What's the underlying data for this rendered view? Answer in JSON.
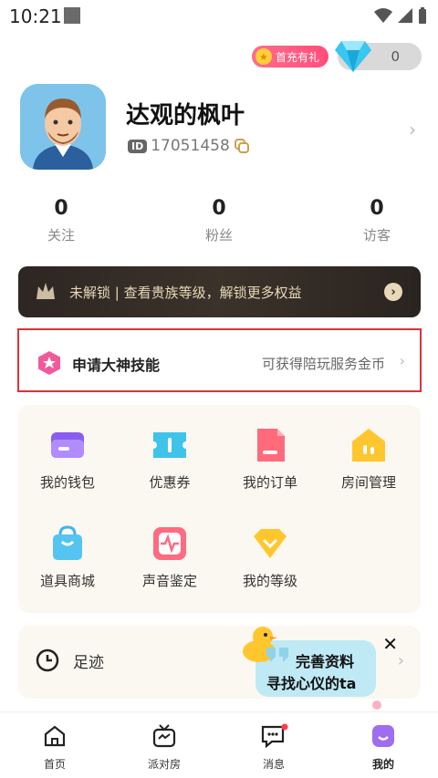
{
  "status_bar": {
    "time": "10:21"
  },
  "top": {
    "gift_label": "首充有礼",
    "diamond_count": "0"
  },
  "profile": {
    "name": "达观的枫叶",
    "id_badge": "ID",
    "user_id": "17051458"
  },
  "stats": [
    {
      "value": "0",
      "label": "关注"
    },
    {
      "value": "0",
      "label": "粉丝"
    },
    {
      "value": "0",
      "label": "访客"
    }
  ],
  "noble_banner": {
    "text": "未解锁 | 查看贵族等级，解锁更多权益"
  },
  "apply_card": {
    "title": "申请大神技能",
    "subtitle": "可获得陪玩服务金币"
  },
  "grid": [
    {
      "label": "我的钱包",
      "icon": "wallet-icon"
    },
    {
      "label": "优惠券",
      "icon": "coupon-icon"
    },
    {
      "label": "我的订单",
      "icon": "order-icon"
    },
    {
      "label": "房间管理",
      "icon": "room-manage-icon"
    },
    {
      "label": "道具商城",
      "icon": "shop-bag-icon"
    },
    {
      "label": "声音鉴定",
      "icon": "voice-icon"
    },
    {
      "label": "我的等级",
      "icon": "level-icon"
    }
  ],
  "footprint": {
    "label": "足迹"
  },
  "popup": {
    "line1": "完善资料",
    "line2": "寻找心仪的ta"
  },
  "tabs": [
    {
      "label": "首页",
      "icon": "home-icon"
    },
    {
      "label": "派对房",
      "icon": "tv-icon"
    },
    {
      "label": "消息",
      "icon": "message-icon"
    },
    {
      "label": "我的",
      "icon": "me-icon"
    }
  ],
  "colors": {
    "accent": "#ff4f7a",
    "highlight_border": "#d8343a",
    "card_bg": "#fbf8f1",
    "noble_text": "#e8d8b8"
  }
}
